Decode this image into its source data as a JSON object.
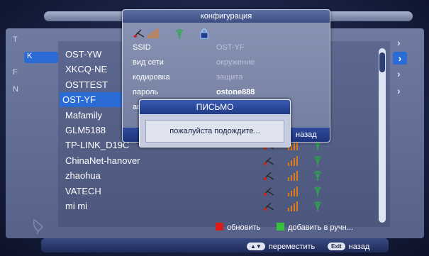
{
  "background_menu": {
    "left_letters": [
      "T",
      "K",
      "F",
      "N"
    ],
    "selected_index": 1
  },
  "network_list": {
    "rows": [
      {
        "name": "OST-YW",
        "selected": false,
        "show_icons": false
      },
      {
        "name": "XKCQ-NE",
        "selected": false,
        "show_icons": false
      },
      {
        "name": "OSTTEST",
        "selected": false,
        "show_icons": false
      },
      {
        "name": "OST-YF",
        "selected": true,
        "show_icons": false
      },
      {
        "name": "Mafamily",
        "selected": false,
        "show_icons": false
      },
      {
        "name": "GLM5188",
        "selected": false,
        "show_icons": false
      },
      {
        "name": "TP-LINK_D19C",
        "selected": false,
        "show_icons": true
      },
      {
        "name": "ChinaNet-hanover",
        "selected": false,
        "show_icons": true
      },
      {
        "name": "zhaohua",
        "selected": false,
        "show_icons": true
      },
      {
        "name": "VATECH",
        "selected": false,
        "show_icons": true
      },
      {
        "name": "mi  mi",
        "selected": false,
        "show_icons": true
      }
    ],
    "icon_names": [
      "router-icon",
      "signal-strength-icon",
      "wifi-icon"
    ]
  },
  "legend": {
    "red_label": "обновить",
    "green_label": "добавить в ручн...",
    "red_color": "#d81c1c",
    "green_color": "#36c23a"
  },
  "footer": {
    "move_key": "▲▼",
    "move_label": "переместить",
    "back_key": "Exit",
    "back_label": "назад"
  },
  "config_dialog": {
    "title": "конфигурация",
    "icon_names": [
      "router-icon",
      "signal-strength-icon",
      "wifi-icon",
      "lock-icon"
    ],
    "fields": [
      {
        "label": "SSID",
        "value": "OST-YF",
        "style": "dim"
      },
      {
        "label": "вид сети",
        "value": "окружение",
        "style": "dim"
      },
      {
        "label": "кодировка",
        "value": "защита",
        "style": "dim"
      },
      {
        "label": "пароль",
        "value": "ostone888",
        "style": "bright"
      },
      {
        "label": "авт",
        "value": "",
        "style": "dim"
      }
    ],
    "back_label": "назад"
  },
  "message_dialog": {
    "title": "ПИСЬМО",
    "text": "пожалуйста подождите..."
  },
  "colors": {
    "accent": "#2b6bd6"
  }
}
